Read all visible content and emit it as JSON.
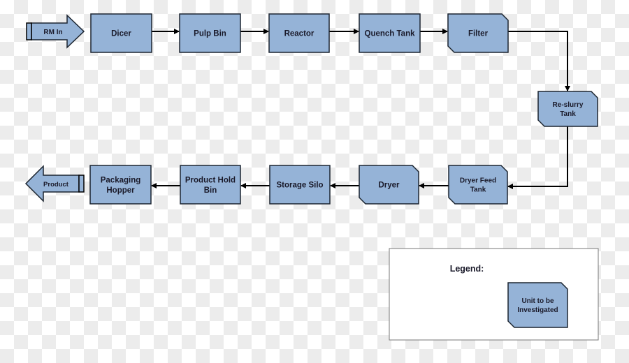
{
  "colors": {
    "unit_fill": "#95b3d7",
    "outline": "#1c2530",
    "connector": "#000000"
  },
  "inlet": {
    "label": "RM In"
  },
  "outlet": {
    "label": "Product"
  },
  "units": [
    {
      "id": "dicer",
      "lines": [
        "Dicer"
      ],
      "investigate": false
    },
    {
      "id": "pulp-bin",
      "lines": [
        "Pulp Bin"
      ],
      "investigate": false
    },
    {
      "id": "reactor",
      "lines": [
        "Reactor"
      ],
      "investigate": false
    },
    {
      "id": "quench-tank",
      "lines": [
        "Quench Tank"
      ],
      "investigate": false
    },
    {
      "id": "filter",
      "lines": [
        "Filter"
      ],
      "investigate": true
    },
    {
      "id": "re-slurry-tank",
      "lines": [
        "Re-slurry",
        "Tank"
      ],
      "investigate": true
    },
    {
      "id": "dryer-feed-tank",
      "lines": [
        "Dryer Feed",
        "Tank"
      ],
      "investigate": true
    },
    {
      "id": "dryer",
      "lines": [
        "Dryer"
      ],
      "investigate": true
    },
    {
      "id": "storage-silo",
      "lines": [
        "Storage Silo"
      ],
      "investigate": false
    },
    {
      "id": "product-hold-bin",
      "lines": [
        "Product Hold",
        "Bin"
      ],
      "investigate": false
    },
    {
      "id": "packaging-hopper",
      "lines": [
        "Packaging",
        "Hopper"
      ],
      "investigate": false
    }
  ],
  "legend": {
    "title": "Legend:",
    "sample_lines": [
      "Unit to be",
      "Investigated"
    ]
  }
}
